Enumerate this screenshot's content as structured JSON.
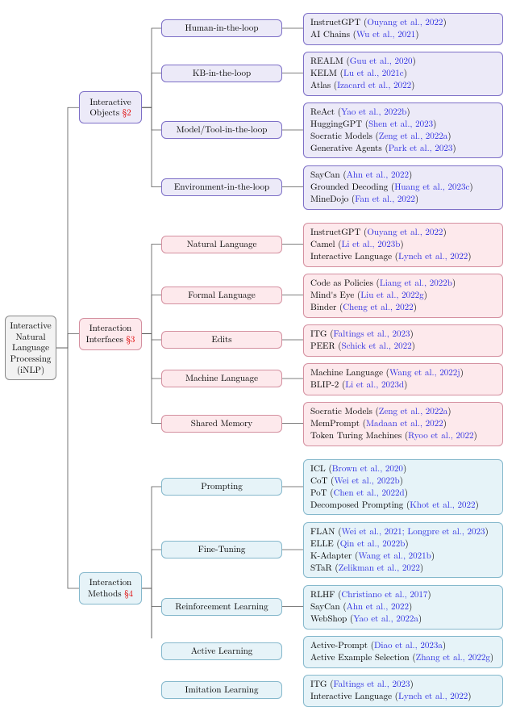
{
  "colors": {
    "root": "#f2f2f2",
    "purple": "#eceaf8",
    "pink": "#fde9ec",
    "blue": "#e6f3f8",
    "cite": "#2a2ae0",
    "sec": "#e00000"
  },
  "tree": {
    "root": {
      "label": "Interactive Natural Language Processing (iNLP)",
      "color": "root"
    },
    "level1": [
      {
        "id": "objects",
        "label": "Interactive Objects",
        "section": "§2",
        "color": "purple"
      },
      {
        "id": "interfaces",
        "label": "Interaction Interfaces",
        "section": "§3",
        "color": "pink"
      },
      {
        "id": "methods",
        "label": "Interaction Methods",
        "section": "§4",
        "color": "blue"
      }
    ],
    "level2": {
      "objects": [
        {
          "id": "hitl",
          "label": "Human-in-the-loop",
          "refs": [
            [
              "InstructGPT",
              "Ouyang et al., 2022"
            ],
            [
              "AI Chains",
              "Wu et al., 2021"
            ]
          ]
        },
        {
          "id": "kbitl",
          "label": "KB-in-the-loop",
          "refs": [
            [
              "REALM",
              "Guu et al., 2020"
            ],
            [
              "KELM",
              "Lu et al., 2021c"
            ],
            [
              "Atlas",
              "Izacard et al., 2022"
            ]
          ]
        },
        {
          "id": "toolitl",
          "label": "Model/Tool-in-the-loop",
          "refs": [
            [
              "ReAct",
              "Yao et al., 2022b"
            ],
            [
              "HuggingGPT",
              "Shen et al., 2023"
            ],
            [
              "Socratic Models",
              "Zeng et al., 2022a"
            ],
            [
              "Generative Agents",
              "Park et al., 2023"
            ]
          ]
        },
        {
          "id": "envitl",
          "label": "Environment-in-the-loop",
          "refs": [
            [
              "SayCan",
              "Ahn et al., 2022"
            ],
            [
              "Grounded Decoding",
              "Huang et al., 2023c"
            ],
            [
              "MineDojo",
              "Fan et al., 2022"
            ]
          ]
        }
      ],
      "interfaces": [
        {
          "id": "nl",
          "label": "Natural Language",
          "refs": [
            [
              "InstructGPT",
              "Ouyang et al., 2022"
            ],
            [
              "Camel",
              "Li et al., 2023b"
            ],
            [
              "Interactive Language",
              "Lynch et al., 2022"
            ]
          ]
        },
        {
          "id": "fl",
          "label": "Formal Language",
          "refs": [
            [
              "Code as Policies",
              "Liang et al., 2022b"
            ],
            [
              "Mind's Eye",
              "Liu et al., 2022g"
            ],
            [
              "Binder",
              "Cheng et al., 2022"
            ]
          ]
        },
        {
          "id": "edits",
          "label": "Edits",
          "refs": [
            [
              "ITG",
              "Faltings et al., 2023"
            ],
            [
              "PEER",
              "Schick et al., 2022"
            ]
          ]
        },
        {
          "id": "ml",
          "label": "Machine Language",
          "refs": [
            [
              "Machine Language",
              "Wang et al., 2022j"
            ],
            [
              "BLIP-2",
              "Li et al., 2023d"
            ]
          ]
        },
        {
          "id": "sm",
          "label": "Shared Memory",
          "refs": [
            [
              "Socratic Models",
              "Zeng et al., 2022a"
            ],
            [
              "MemPrompt",
              "Madaan et al., 2022"
            ],
            [
              "Token Turing Machines",
              "Ryoo et al., 2022"
            ]
          ]
        }
      ],
      "methods": [
        {
          "id": "prompt",
          "label": "Prompting",
          "refs": [
            [
              "ICL",
              "Brown et al., 2020"
            ],
            [
              "CoT",
              "Wei et al., 2022b"
            ],
            [
              "PoT",
              "Chen et al., 2022d"
            ],
            [
              "Decomposed Prompting",
              "Khot et al., 2022"
            ]
          ]
        },
        {
          "id": "ft",
          "label": "Fine-Tuning",
          "refs": [
            [
              "FLAN",
              "Wei et al., 2021; Longpre et al., 2023"
            ],
            [
              "ELLE",
              "Qin et al., 2022b"
            ],
            [
              "K-Adapter",
              "Wang et al., 2021b"
            ],
            [
              "STaR",
              "Zelikman et al., 2022"
            ]
          ]
        },
        {
          "id": "rl",
          "label": "Reinforcement Learning",
          "refs": [
            [
              "RLHF",
              "Christiano et al., 2017"
            ],
            [
              "SayCan",
              "Ahn et al., 2022"
            ],
            [
              "WebShop",
              "Yao et al., 2022a"
            ]
          ]
        },
        {
          "id": "al",
          "label": "Active Learning",
          "refs": [
            [
              "Active-Prompt",
              "Diao et al., 2023a"
            ],
            [
              "Active Example Selection",
              "Zhang et al., 2022g"
            ]
          ]
        },
        {
          "id": "il",
          "label": "Imitation Learning",
          "refs": [
            [
              "ITG",
              "Faltings et al., 2023"
            ],
            [
              "Interactive Language",
              "Lynch et al., 2022"
            ]
          ]
        }
      ]
    }
  },
  "chart_data": {
    "type": "tree",
    "title": "Taxonomy of Interactive Natural Language Processing (iNLP)",
    "root": "Interactive Natural Language Processing (iNLP)",
    "branches": [
      {
        "name": "Interactive Objects §2",
        "children": [
          "Human-in-the-loop",
          "KB-in-the-loop",
          "Model/Tool-in-the-loop",
          "Environment-in-the-loop"
        ]
      },
      {
        "name": "Interaction Interfaces §3",
        "children": [
          "Natural Language",
          "Formal Language",
          "Edits",
          "Machine Language",
          "Shared Memory"
        ]
      },
      {
        "name": "Interaction Methods §4",
        "children": [
          "Prompting",
          "Fine-Tuning",
          "Reinforcement Learning",
          "Active Learning",
          "Imitation Learning"
        ]
      }
    ]
  }
}
